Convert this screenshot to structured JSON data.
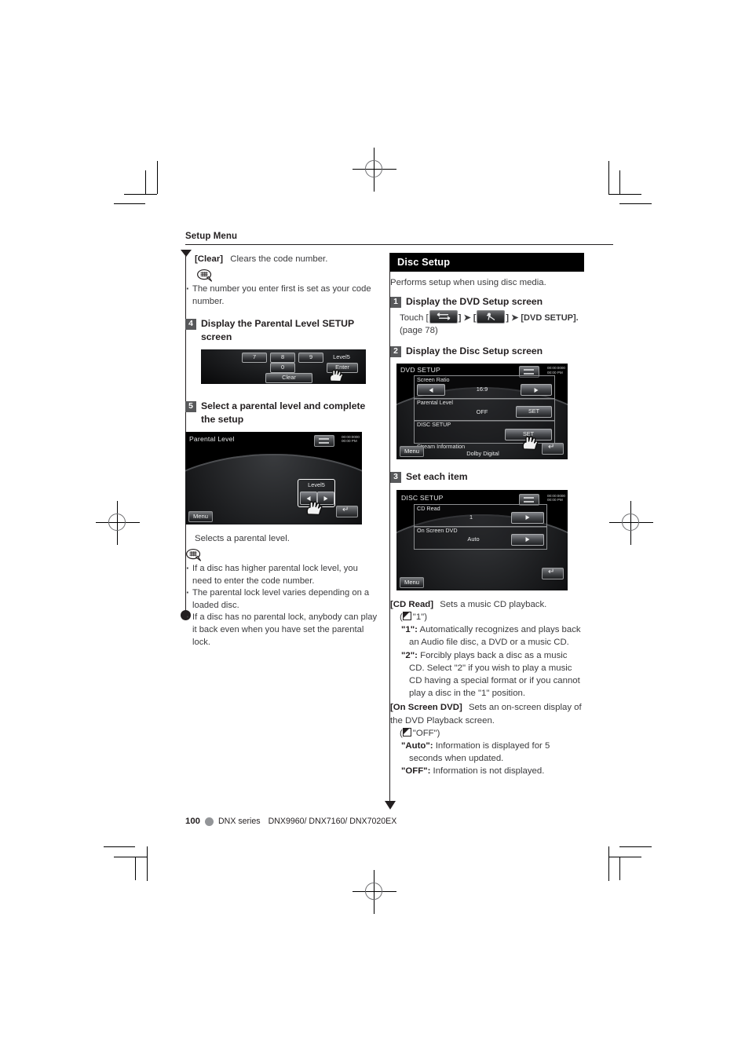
{
  "document": {
    "running_head": "Setup Menu",
    "footer": {
      "page_number": "100",
      "series": "DNX series",
      "models": "DNX9960/ DNX7160/ DNX7020EX"
    }
  },
  "left_column": {
    "clear_term": "[Clear]",
    "clear_desc": "Clears the code number.",
    "note_icon": "note-bubble-icon",
    "note_bullets": [
      "The number you enter first is set as your code number."
    ],
    "step4": {
      "number": "4",
      "title": "Display the Parental Level SETUP screen"
    },
    "keypad_shot": {
      "name": "parental-level-setup-keypad-screenshot",
      "keys": [
        "7",
        "8",
        "9",
        "0"
      ],
      "clear_label": "Clear",
      "level_label": "Level5",
      "enter_label": "Enter",
      "hand_icon": "hand-pointer-icon"
    },
    "step5": {
      "number": "5",
      "title": "Select a parental level and complete the setup"
    },
    "parental_shot": {
      "name": "parental-level-screenshot",
      "title": "Parental Level",
      "clock": "00:00:0000\n00:00 PM",
      "level_label": "Level5",
      "menu_label": "Menu",
      "left_arrow": "left-arrow-button",
      "right_arrow": "right-arrow-button",
      "back_icon": "back-arrow-icon",
      "source_icon": "source-switch-icon",
      "hand_icon": "hand-pointer-icon"
    },
    "caption": "Selects a parental level.",
    "bullets": [
      "If a disc has higher parental lock level, you need to enter the code number.",
      "The parental lock level varies depending on a loaded disc.",
      "If a disc has no parental lock, anybody can play it back even when you have set the parental lock."
    ]
  },
  "right_column": {
    "section_title": "Disc Setup",
    "intro": "Performs setup when using disc media.",
    "step1": {
      "number": "1",
      "title": "Display the DVD Setup screen",
      "touch_prefix": "Touch [",
      "key1_icon": "source-switch-icon",
      "sep1": "] ➤ [",
      "key2_icon": "setup-wrench-icon",
      "sep2": "] ➤ [DVD SETUP].",
      "page_ref": "(page 78)"
    },
    "step2": {
      "number": "2",
      "title": "Display the Disc Setup screen"
    },
    "dvd_setup_shot": {
      "name": "dvd-setup-screenshot",
      "title": "DVD SETUP",
      "clock": "00:00:0000\n00:00 PM",
      "rows": [
        {
          "label": "Screen Ratio",
          "value": "16:9",
          "control": "arrows"
        },
        {
          "label": "Parental Level",
          "value": "OFF",
          "control": "SET"
        },
        {
          "label": "DISC SETUP",
          "value": "",
          "control": "SET"
        },
        {
          "label": "Stream Information",
          "value": "Dolby Digital",
          "control": "none"
        }
      ],
      "menu_label": "Menu",
      "set_label": "SET",
      "hand_icon": "hand-pointer-icon"
    },
    "step3": {
      "number": "3",
      "title": "Set each item"
    },
    "disc_setup_shot": {
      "name": "disc-setup-screenshot",
      "title": "DISC SETUP",
      "clock": "00:00:0000\n00:00 PM",
      "rows": [
        {
          "label": "CD Read",
          "value": "1",
          "control": "arrow"
        },
        {
          "label": "On Screen DVD",
          "value": "Auto",
          "control": "arrow"
        }
      ],
      "menu_label": "Menu"
    },
    "cd_read": {
      "term": "[CD Read]",
      "desc": "Sets a music CD playback.",
      "default": "\"1\"",
      "options": [
        {
          "key": "\"1\":",
          "desc": "Automatically recognizes and plays back an Audio file disc, a DVD or a music CD."
        },
        {
          "key": "\"2\":",
          "desc": "Forcibly plays back a disc as a music CD. Select \"2\" if you wish to play a music CD having a special format or if you cannot play a disc in the \"1\" position."
        }
      ]
    },
    "on_screen_dvd": {
      "term": "[On Screen DVD]",
      "desc": "Sets an on-screen display of the DVD Playback screen.",
      "default": "\"OFF\"",
      "options": [
        {
          "key": "\"Auto\":",
          "desc": "Information is displayed for 5 seconds when updated."
        },
        {
          "key": "\"OFF\":",
          "desc": "Information is not displayed."
        }
      ]
    }
  }
}
